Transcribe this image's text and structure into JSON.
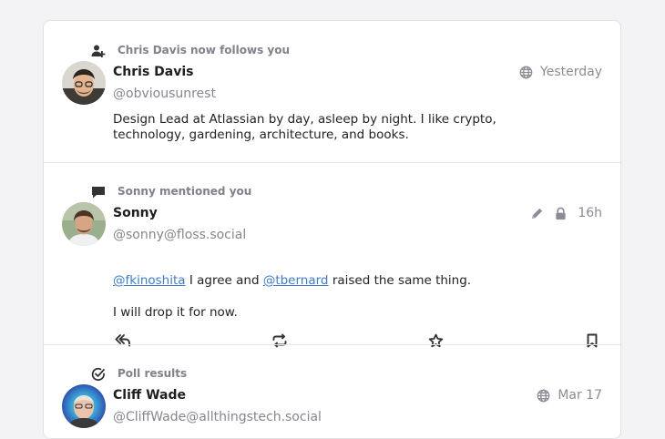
{
  "notifications": [
    {
      "context_label": "Chris Davis now follows you",
      "context_icon": "person-add-icon",
      "name": "Chris Davis",
      "handle": "@obviousunrest",
      "visibility_icon": "globe-icon",
      "time": "Yesterday",
      "bio": "Design Lead at Atlassian by day, asleep by night. I like crypto, technology, gardening, architecture, and books."
    },
    {
      "context_label": "Sonny mentioned you",
      "context_icon": "speech-bubble-icon",
      "name": "Sonny",
      "handle": "@sonny@floss.social",
      "edited_icon": "pencil-icon",
      "visibility_icon": "lock-icon",
      "time": "16h",
      "mention_1": "@fkinoshita",
      "text_between": "I agree and",
      "mention_2": "@tbernard",
      "text_after": "raised the same thing.",
      "second_paragraph": "I will drop it for now.",
      "actions": [
        "reply-all-icon",
        "boost-icon",
        "star-icon",
        "bookmark-icon"
      ]
    },
    {
      "context_label": "Poll results",
      "context_icon": "check-circle-icon",
      "name": "Cliff Wade",
      "handle": "@CliffWade@allthingstech.social",
      "visibility_icon": "globe-icon",
      "time": "Mar 17"
    }
  ],
  "colors": {
    "link": "#3f7bc7",
    "muted": "#8b8c95",
    "border": "#e5e5e9"
  }
}
